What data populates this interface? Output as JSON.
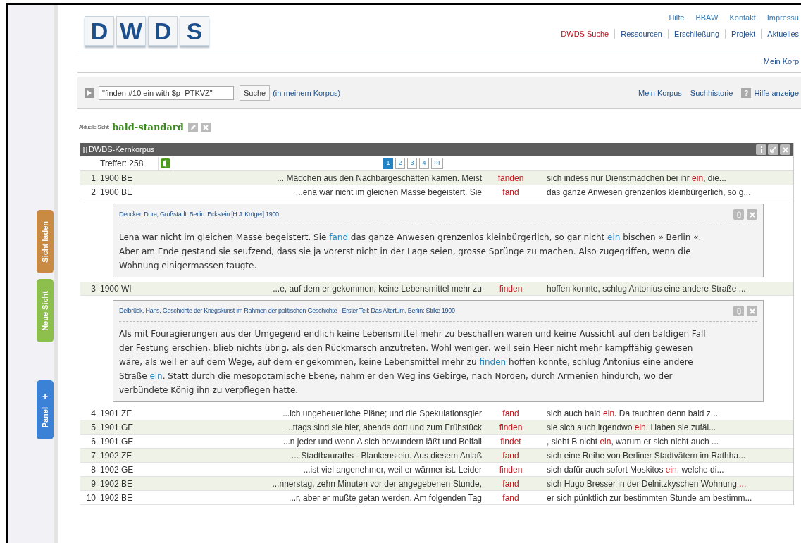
{
  "logo": {
    "letters": [
      "D",
      "W",
      "D",
      "S"
    ]
  },
  "top_links": [
    "Hilfe",
    "BBAW",
    "Kontakt",
    "Impressu"
  ],
  "nav": [
    {
      "label": "DWDS Suche",
      "selected": true
    },
    {
      "label": "Ressourcen",
      "selected": false
    },
    {
      "label": "Erschließung",
      "selected": false
    },
    {
      "label": "Projekt",
      "selected": false
    },
    {
      "label": "Aktuelles",
      "selected": false
    }
  ],
  "sub_nav": "Mein Korp",
  "search": {
    "value": "\"finden #10 ein with $p=PTKVZ\"",
    "button": "Suche",
    "scope": "(in meinem Korpus)",
    "links": [
      "Mein Korpus",
      "Suchhistorie"
    ],
    "help": "Hilfe anzeige",
    "help_icon": "?"
  },
  "view": {
    "label": "Aktuelle Sicht:",
    "name": "bald-standard"
  },
  "side_tabs": [
    {
      "label": "Sicht laden",
      "color": "#c98b44",
      "kind": "plain"
    },
    {
      "label": "Neue Sicht",
      "color": "#8dbf4e",
      "kind": "plain"
    },
    {
      "label": "Panel",
      "color": "#3b82d6",
      "kind": "plus",
      "icon": "+"
    }
  ],
  "panel": {
    "title": "DWDS-Kernkorpus",
    "hits": "Treffer: 258",
    "pages": [
      {
        "label": "1",
        "selected": true
      },
      {
        "label": "2",
        "selected": false
      },
      {
        "label": "3",
        "selected": false
      },
      {
        "label": "4",
        "selected": false
      },
      {
        "label": "››I",
        "selected": false
      }
    ],
    "rows": [
      {
        "n": "1",
        "source": "1900 BE",
        "left": "... Mädchen aus den Nachbargeschäften kamen. Meist",
        "keyword": "fanden",
        "right": [
          {
            "text": "sich indess nur Dienstmädchen bei ihr ",
            "highlight": false
          },
          {
            "text": "ein",
            "highlight": true
          },
          {
            "text": ", die...",
            "highlight": false
          }
        ]
      },
      {
        "n": "2",
        "source": "1900 BE",
        "left": "...ena war nicht im gleichen Masse begeistert. Sie",
        "keyword": "fand",
        "right": [
          {
            "text": "das ganze Anwesen grenzenlos kleinbürgerlich, so g...",
            "highlight": false
          }
        ],
        "detail": {
          "citation": "Dencker, Dora, Großstadt, Berlin: Eckstein [H.J. Krüger] 1900",
          "text": [
            {
              "text": "Lena war nicht im gleichen Masse begeistert. Sie ",
              "highlight": false
            },
            {
              "text": "fand",
              "highlight": true
            },
            {
              "text": " das ganze Anwesen grenzenlos kleinbürgerlich, so gar nicht ",
              "highlight": false
            },
            {
              "text": "ein",
              "highlight": true
            },
            {
              "text": " bischen » Berlin «. Aber am Ende gestand sie seufzend, dass sie ja vorerst nicht in der Lage seien, grosse Sprünge zu machen. Also zugegriffen, wenn die Wohnung einigermassen taugte.",
              "highlight": false
            }
          ]
        }
      },
      {
        "n": "3",
        "source": "1900 WI",
        "left": "...e, auf dem er gekommen, keine Lebensmittel mehr zu",
        "keyword": "finden",
        "right": [
          {
            "text": "hoffen konnte, schlug Antonius eine andere Straße ...",
            "highlight": false
          }
        ],
        "detail": {
          "citation": "Delbrück, Hans, Geschichte der Kriegskunst im Rahmen der politischen Geschichte - Erster Teil: Das Altertum, Berlin: Stilke 1900",
          "text": [
            {
              "text": "Als mit Fouragierungen aus der Umgegend endlich keine Lebensmittel mehr zu beschaffen waren und keine Aussicht auf den baldigen Fall der Festung erschien, blieb nichts übrig, als den Rückmarsch anzutreten. Wohl weniger, weil sein Heer nicht mehr kampffähig gewesen wäre, als weil er auf dem Wege, auf dem er gekommen, keine Lebensmittel mehr zu ",
              "highlight": false
            },
            {
              "text": "finden",
              "highlight": true
            },
            {
              "text": " hoffen konnte, schlug Antonius eine andere Straße ",
              "highlight": false
            },
            {
              "text": "ein",
              "highlight": true
            },
            {
              "text": ". Statt durch die mesopotamische Ebene, nahm er den Weg ins Gebirge, nach Norden, durch Armenien hindurch, wo der verbündete König ihn zu verpflegen hatte.",
              "highlight": false
            }
          ]
        }
      },
      {
        "n": "4",
        "source": "1901 ZE",
        "left": "...ich ungeheuerliche Pläne; und die Spekulationsgier",
        "keyword": "fand",
        "right": [
          {
            "text": "sich auch bald ",
            "highlight": false
          },
          {
            "text": "ein",
            "highlight": true
          },
          {
            "text": ". Da tauchten denn bald z...",
            "highlight": false
          }
        ]
      },
      {
        "n": "5",
        "source": "1901 GE",
        "left": "...ttags sind sie hier, abends dort und zum Frühstück",
        "keyword": "finden",
        "right": [
          {
            "text": "sie sich auch irgendwo ",
            "highlight": false
          },
          {
            "text": "ein",
            "highlight": true
          },
          {
            "text": ". Haben sie zufäl...",
            "highlight": false
          }
        ]
      },
      {
        "n": "6",
        "source": "1901 GE",
        "left": "...n jeder und wenn A sich bewundern läßt und Beifall",
        "keyword": "findet",
        "right": [
          {
            "text": ", sieht B nicht ",
            "highlight": false
          },
          {
            "text": "ein",
            "highlight": true
          },
          {
            "text": ", warum er sich nicht auch ...",
            "highlight": false
          }
        ]
      },
      {
        "n": "7",
        "source": "1902 ZE",
        "left": "... Stadtbauraths - Blankenstein. Aus diesem Anlaß",
        "keyword": "fand",
        "right": [
          {
            "text": "sich eine Reihe von Berliner Stadtvätern im Rathha...",
            "highlight": false
          }
        ]
      },
      {
        "n": "8",
        "source": "1902 GE",
        "left": "...ist viel angenehmer, weil er wärmer ist. Leider",
        "keyword": "finden",
        "right": [
          {
            "text": "sich dafür auch sofort Moskitos ",
            "highlight": false
          },
          {
            "text": "ein",
            "highlight": true
          },
          {
            "text": ", welche di...",
            "highlight": false
          }
        ]
      },
      {
        "n": "9",
        "source": "1902 BE",
        "left": "...nnerstag, zehn Minuten vor der angegebenen Stunde,",
        "keyword": "fand",
        "right": [
          {
            "text": "sich Hugo Bresser in der Delnitzkyschen Wohnung ",
            "highlight": false
          },
          {
            "text": "...",
            "highlight": true
          }
        ]
      },
      {
        "n": "10",
        "source": "1902 BE",
        "left": "...r, aber er mußte getan werden. Am folgenden Tag",
        "keyword": "fand",
        "right": [
          {
            "text": "er sich pünktlich zur bestimmten Stunde am bestimm...",
            "highlight": false
          }
        ]
      }
    ]
  }
}
